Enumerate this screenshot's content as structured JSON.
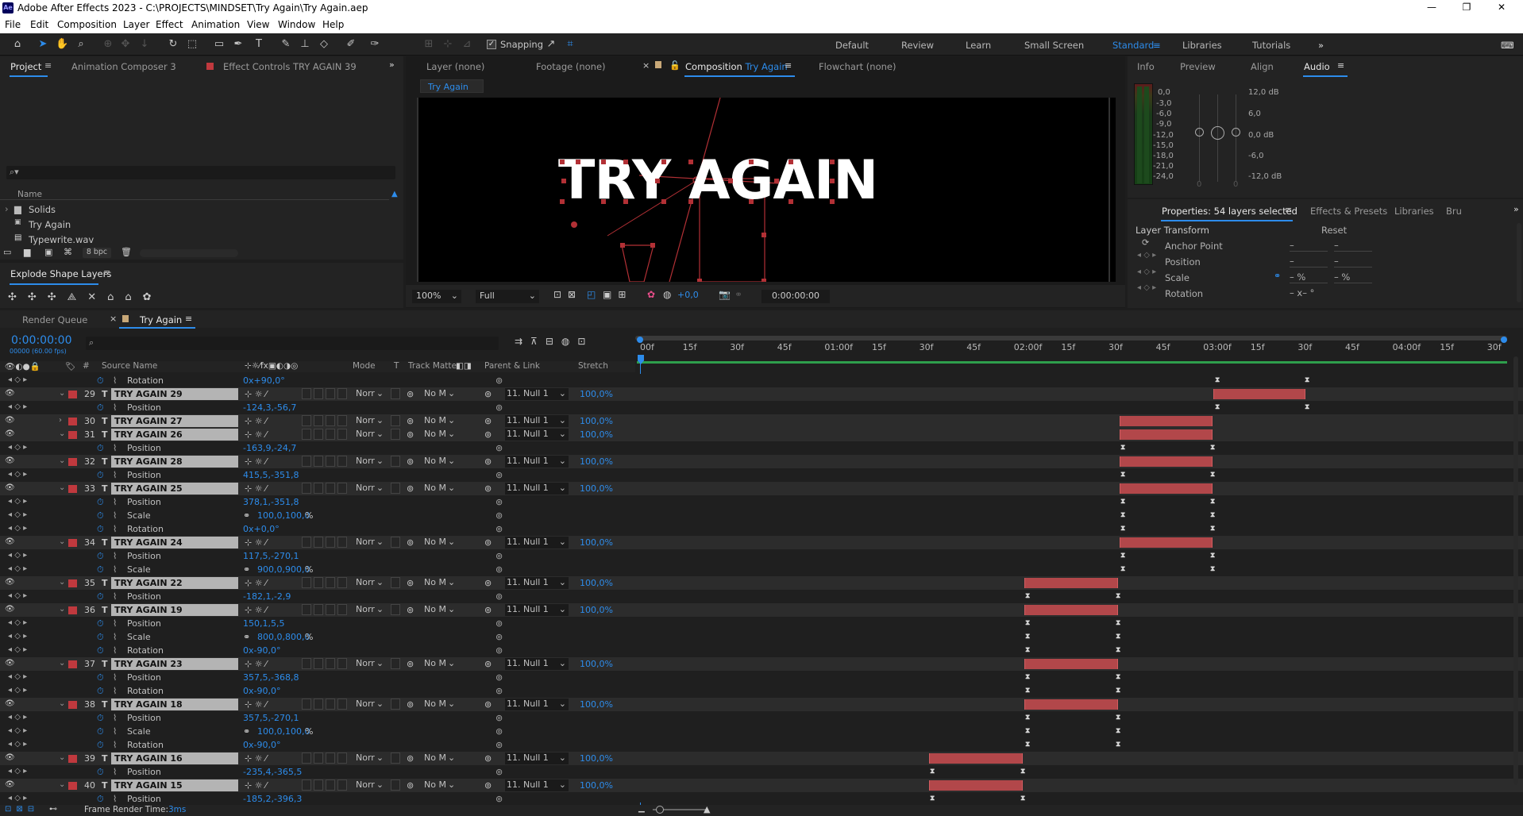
{
  "app": {
    "title": "Adobe After Effects 2023 - C:\\PROJECTS\\MINDSET\\Try Again\\Try Again.aep",
    "logo": "Ae"
  },
  "menu": [
    "File",
    "Edit",
    "Composition",
    "Layer",
    "Effect",
    "Animation",
    "View",
    "Window",
    "Help"
  ],
  "toolbar": {
    "snapping_label": "Snapping",
    "workspaces": [
      "Default",
      "Review",
      "Learn",
      "Small Screen",
      "Standard",
      "Libraries",
      "Tutorials"
    ],
    "active_workspace": "Standard"
  },
  "project_panel": {
    "tabs": [
      "Project",
      "Animation Composer 3",
      "Effect Controls TRY AGAIN 39"
    ],
    "search_placeholder": "",
    "col_name": "Name",
    "items": [
      {
        "name": "Solids",
        "icon": "folder-icon"
      },
      {
        "name": "Try Again",
        "icon": "composition-icon"
      },
      {
        "name": "Typewrite.wav",
        "icon": "audio-file-icon"
      }
    ],
    "bpc": "8 bpc"
  },
  "explode_panel": {
    "title": "Explode Shape Layers"
  },
  "viewer": {
    "tabs": [
      "Layer (none)",
      "Footage (none)",
      "Composition",
      "Flowchart (none)"
    ],
    "comp_name": "Try Again",
    "breadcrumb": "Try Again",
    "canvas_text": "TRY AGAIN",
    "zoom": "100%",
    "resolution": "Full",
    "exposure": "+0,0",
    "timecode": "0:00:00:00"
  },
  "audio_panel": {
    "tabs": [
      "Info",
      "Preview",
      "Align",
      "Audio"
    ],
    "active": "Audio",
    "left_scale": [
      "0,0",
      "-3,0",
      "-6,0",
      "-9,0",
      "-12,0",
      "-15,0",
      "-18,0",
      "-21,0",
      "-24,0"
    ],
    "right_scale": [
      "12,0 dB",
      "6,0",
      "0,0 dB",
      "-6,0",
      "-12,0 dB"
    ],
    "slider_zero_a": "0",
    "slider_zero_b": "0"
  },
  "properties_panel": {
    "tabs": [
      "Properties: 54 layers selected",
      "Effects & Presets",
      "Libraries",
      "Bru"
    ],
    "section": "Layer Transform",
    "reset": "Reset",
    "props": [
      {
        "name": "Anchor Point",
        "v1": "–",
        "v2": "–"
      },
      {
        "name": "Position",
        "v1": "–",
        "v2": "–"
      },
      {
        "name": "Scale",
        "v1": "– %",
        "v2": "– %"
      },
      {
        "name": "Rotation",
        "v1": "– x– °",
        "v2": ""
      }
    ]
  },
  "timeline": {
    "tabs": [
      "Render Queue",
      "Try Again"
    ],
    "timecode": "0:00:00:00",
    "fps": "00000 (60.00 fps)",
    "columns": {
      "source": "Source Name",
      "mode": "Mode",
      "t": "T",
      "track_matte": "Track Matte",
      "parent": "Parent & Link",
      "stretch": "Stretch"
    },
    "ruler": [
      "00f",
      "15f",
      "30f",
      "45f",
      "01:00f",
      "15f",
      "30f",
      "45f",
      "02:00f",
      "15f",
      "30f",
      "45f",
      "03:00f",
      "15f",
      "30f",
      "45f",
      "04:00f",
      "15f",
      "30f"
    ],
    "frame_render_label": "Frame Render Time:",
    "frame_render_value": "3ms",
    "rows": [
      {
        "type": "prop",
        "name": "Rotation",
        "value": "0x+90,0°",
        "kf": [
          1530,
          1643
        ]
      },
      {
        "type": "layer",
        "num": "29",
        "name": "TRY AGAIN 29",
        "open": true,
        "bar": [
          1528,
          1644
        ]
      },
      {
        "type": "prop",
        "name": "Position",
        "value": "-124,3,-56,7",
        "kf": [
          1530,
          1643
        ]
      },
      {
        "type": "layer",
        "num": "30",
        "name": "TRY AGAIN 27",
        "open": false,
        "bar": [
          1410,
          1527
        ]
      },
      {
        "type": "layer",
        "num": "31",
        "name": "TRY AGAIN 26",
        "open": true,
        "bar": [
          1410,
          1527
        ]
      },
      {
        "type": "prop",
        "name": "Position",
        "value": "-163,9,-24,7",
        "kf": [
          1411,
          1524
        ]
      },
      {
        "type": "layer",
        "num": "32",
        "name": "TRY AGAIN 28",
        "open": true,
        "bar": [
          1410,
          1527
        ]
      },
      {
        "type": "prop",
        "name": "Position",
        "value": "415,5,-351,8",
        "kf": [
          1411,
          1524
        ]
      },
      {
        "type": "layer",
        "num": "33",
        "name": "TRY AGAIN 25",
        "open": true,
        "bar": [
          1410,
          1527
        ]
      },
      {
        "type": "prop",
        "name": "Position",
        "value": "378,1,-351,8",
        "kf": [
          1411,
          1524
        ]
      },
      {
        "type": "prop",
        "name": "Scale",
        "value": "100,0,100,0",
        "pct": true,
        "link": true,
        "kf": [
          1411,
          1524
        ]
      },
      {
        "type": "prop",
        "name": "Rotation",
        "value": "0x+0,0°",
        "kf": [
          1411,
          1524
        ]
      },
      {
        "type": "layer",
        "num": "34",
        "name": "TRY AGAIN 24",
        "open": true,
        "bar": [
          1410,
          1527
        ]
      },
      {
        "type": "prop",
        "name": "Position",
        "value": "117,5,-270,1",
        "kf": [
          1411,
          1524
        ]
      },
      {
        "type": "prop",
        "name": "Scale",
        "value": "900,0,900,0",
        "pct": true,
        "link": true,
        "kf": [
          1411,
          1524
        ]
      },
      {
        "type": "layer",
        "num": "35",
        "name": "TRY AGAIN 22",
        "open": true,
        "bar": [
          1290,
          1408
        ]
      },
      {
        "type": "prop",
        "name": "Position",
        "value": "-182,1,-2,9",
        "kf": [
          1291,
          1405
        ]
      },
      {
        "type": "layer",
        "num": "36",
        "name": "TRY AGAIN 19",
        "open": true,
        "bar": [
          1290,
          1408
        ]
      },
      {
        "type": "prop",
        "name": "Position",
        "value": "150,1,5,5",
        "kf": [
          1291,
          1405
        ]
      },
      {
        "type": "prop",
        "name": "Scale",
        "value": "800,0,800,0",
        "pct": true,
        "link": true,
        "kf": [
          1291,
          1405
        ]
      },
      {
        "type": "prop",
        "name": "Rotation",
        "value": "0x-90,0°",
        "kf": [
          1291,
          1405
        ]
      },
      {
        "type": "layer",
        "num": "37",
        "name": "TRY AGAIN 23",
        "open": true,
        "bar": [
          1290,
          1408
        ]
      },
      {
        "type": "prop",
        "name": "Position",
        "value": "357,5,-368,8",
        "kf": [
          1291,
          1405
        ]
      },
      {
        "type": "prop",
        "name": "Rotation",
        "value": "0x-90,0°",
        "kf": [
          1291,
          1405
        ]
      },
      {
        "type": "layer",
        "num": "38",
        "name": "TRY AGAIN 18",
        "open": true,
        "bar": [
          1290,
          1408
        ]
      },
      {
        "type": "prop",
        "name": "Position",
        "value": "357,5,-270,1",
        "kf": [
          1291,
          1405
        ]
      },
      {
        "type": "prop",
        "name": "Scale",
        "value": "100,0,100,0",
        "pct": true,
        "link": true,
        "kf": [
          1291,
          1405
        ]
      },
      {
        "type": "prop",
        "name": "Rotation",
        "value": "0x-90,0°",
        "kf": [
          1291,
          1405
        ]
      },
      {
        "type": "layer",
        "num": "39",
        "name": "TRY AGAIN 16",
        "open": true,
        "bar": [
          1170,
          1288
        ]
      },
      {
        "type": "prop",
        "name": "Position",
        "value": "-235,4,-365,5",
        "kf": [
          1171,
          1285
        ]
      },
      {
        "type": "layer",
        "num": "40",
        "name": "TRY AGAIN 15",
        "open": true,
        "bar": [
          1170,
          1288
        ]
      },
      {
        "type": "prop",
        "name": "Position",
        "value": "-185,2,-396,3",
        "kf": [
          1171,
          1285
        ]
      }
    ],
    "layer_mode": "Norr",
    "layer_matte": "No M",
    "layer_parent": "11. Null 1",
    "layer_stretch": "100,0%"
  }
}
